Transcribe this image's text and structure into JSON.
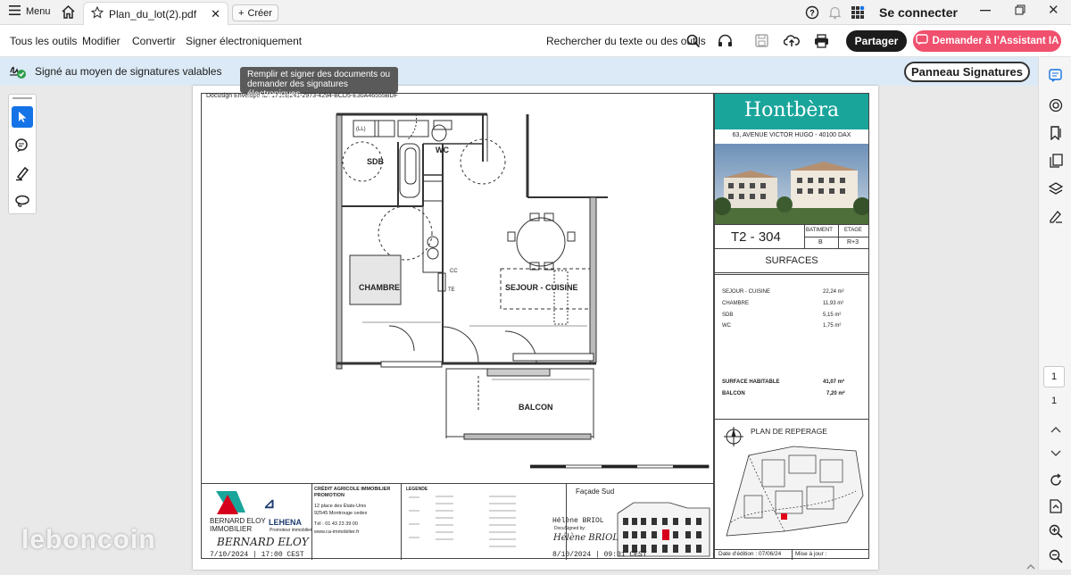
{
  "tabbar": {
    "menu_label": "Menu",
    "tab_title": "Plan_du_lot(2).pdf",
    "create_label": "Créer",
    "connect_label": "Se connecter"
  },
  "toolbar": {
    "items": [
      "Tous les outils",
      "Modifier",
      "Convertir",
      "Signer électroniquement"
    ],
    "search_label": "Rechercher du texte ou des outils",
    "share_label": "Partager",
    "ai_label": "Demander à l’Assistant IA"
  },
  "sigbar": {
    "status_text": "Signé au moyen de signatures valables",
    "panel_button": "Panneau Signatures",
    "tooltip": "Remplir et signer des documents ou demander des signatures électroniques"
  },
  "pager": {
    "current": "1",
    "total": "1"
  },
  "document": {
    "envelope_id": "Docusign Envelope ID: 1715E241-2973-4294-BCD5-E30A46555BDF",
    "brand": "Hontbèra",
    "address": "63, AVENUE VICTOR HUGO - 40100 DAX",
    "lot": "T2 - 304",
    "batiment_label": "BATIMENT",
    "etage_label": "ETAGE",
    "batiment": "B",
    "etage": "R+3",
    "surfaces_title": "SURFACES",
    "surfaces": [
      {
        "name": "SEJOUR - CUISINE",
        "value": "22,24 m²"
      },
      {
        "name": "CHAMBRE",
        "value": "11,93 m²"
      },
      {
        "name": "SDB",
        "value": "5,15 m²"
      },
      {
        "name": "WC",
        "value": "1,75 m²"
      }
    ],
    "surface_habitable_label": "SURFACE HABITABLE",
    "surface_habitable": "41,07 m²",
    "balcon_label": "BALCON",
    "balcon": "7,20 m²",
    "plan_reperage": "PLAN DE REPERAGE",
    "edition": "Date d'édition : 07/06/24",
    "maj": "Mise à jour :",
    "rooms": {
      "sdb": "SDB",
      "wc": "WC",
      "chambre": "CHAMBRE",
      "sejour": "SEJOUR - CUISINE",
      "balcon": "BALCON",
      "ll": "(LL)",
      "te": "TE",
      "cc": "CC"
    },
    "legend_title": "LEGENDE",
    "promoter_title": "CRÉDIT AGRICOLE IMMOBILIER PROMOTION",
    "promoter_addr1": "12 place des États-Unis",
    "promoter_addr2": "92545 Montrouge cedex",
    "promoter_tel": "Tél : 01 43 23 39 00",
    "promoter_web": "www.ca-immobilier.fr",
    "ca_name": "BERNARD ELOY",
    "ca_sub": "IMMOBILIER",
    "lehena": "LEHENA",
    "lehena_sub": "Promoteur immobilier",
    "sig_left": "BERNARD ELOY",
    "sig_left_date": "7/10/2024 | 17:00 CEST",
    "facade": "Façade Sud",
    "signer_right": "Hélène BRIOL",
    "docusigned": "DocuSigned by:",
    "sig_right": "Hélène BRIOL",
    "sig_right_date": "8/10/2024 | 09:01 CEST"
  },
  "watermark": "leboncoin",
  "colors": {
    "accent_blue": "#1473e6",
    "brand_teal": "#1aa59b",
    "ai_pink": "#f0506e",
    "sigbar": "#dbeaf6"
  }
}
